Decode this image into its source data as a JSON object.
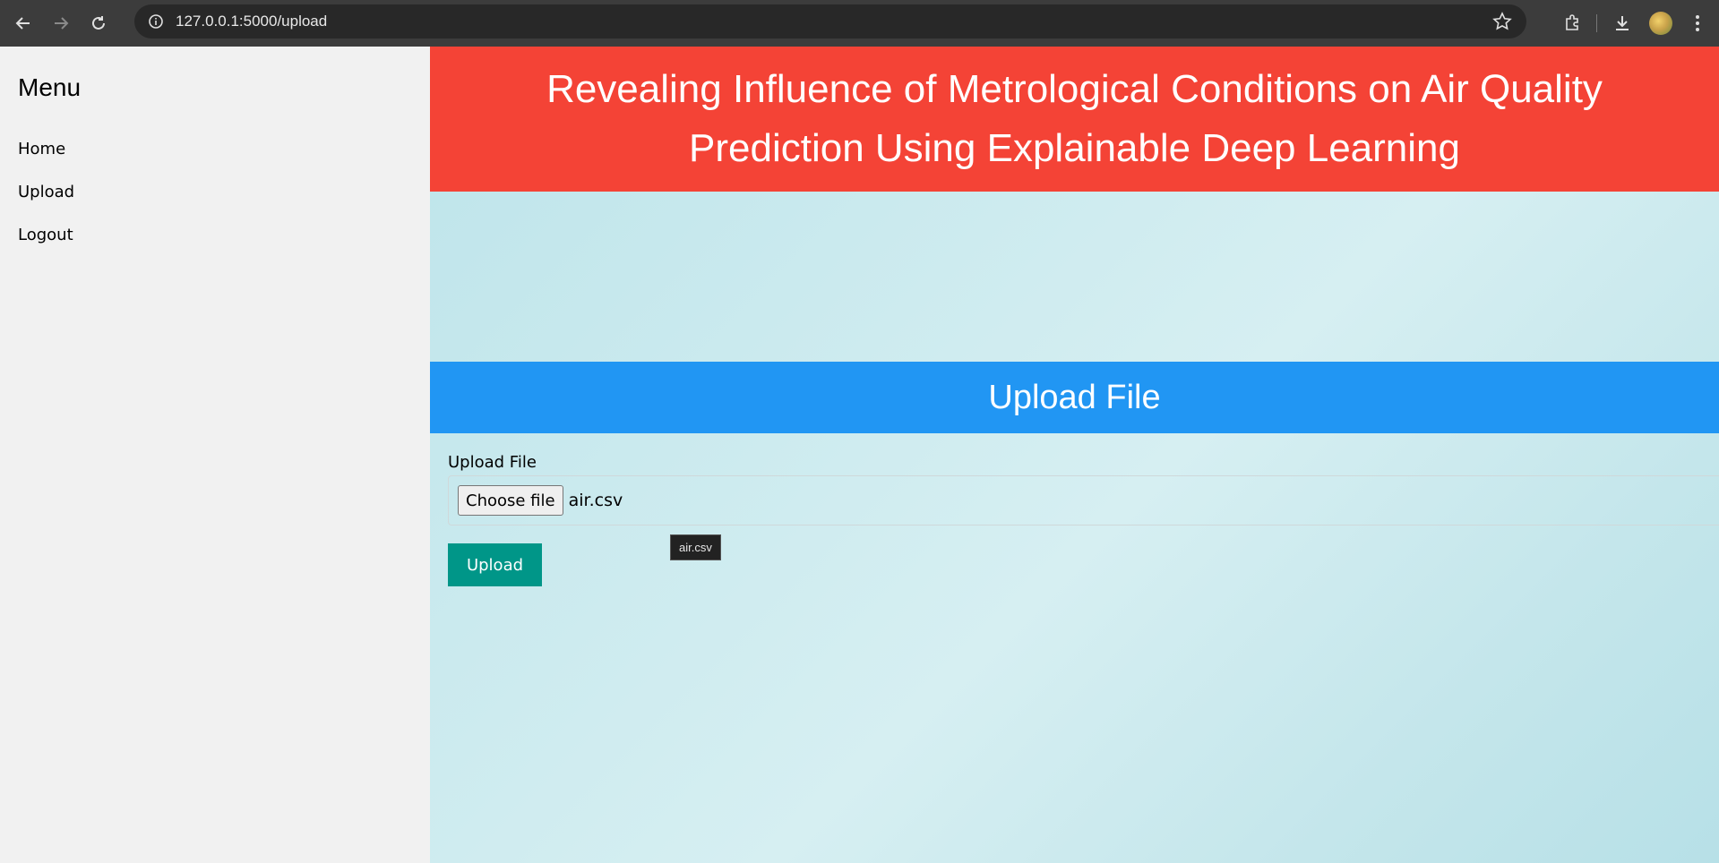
{
  "browser": {
    "url": "127.0.0.1:5000/upload"
  },
  "sidebar": {
    "title": "Menu",
    "items": [
      {
        "label": "Home"
      },
      {
        "label": "Upload"
      },
      {
        "label": "Logout"
      }
    ]
  },
  "header": {
    "title_line1": "Revealing Influence of Metrological Conditions on Air Quality",
    "title_line2": "Prediction Using Explainable Deep Learning"
  },
  "upload_section": {
    "heading": "Upload File",
    "field_label": "Upload File",
    "choose_button": "Choose file",
    "selected_file": "air.csv",
    "tooltip": "air.csv",
    "submit_button": "Upload"
  },
  "colors": {
    "header": "#f44336",
    "section_bar": "#2196f3",
    "submit_button": "#009688",
    "sidebar": "#f1f1f1"
  }
}
